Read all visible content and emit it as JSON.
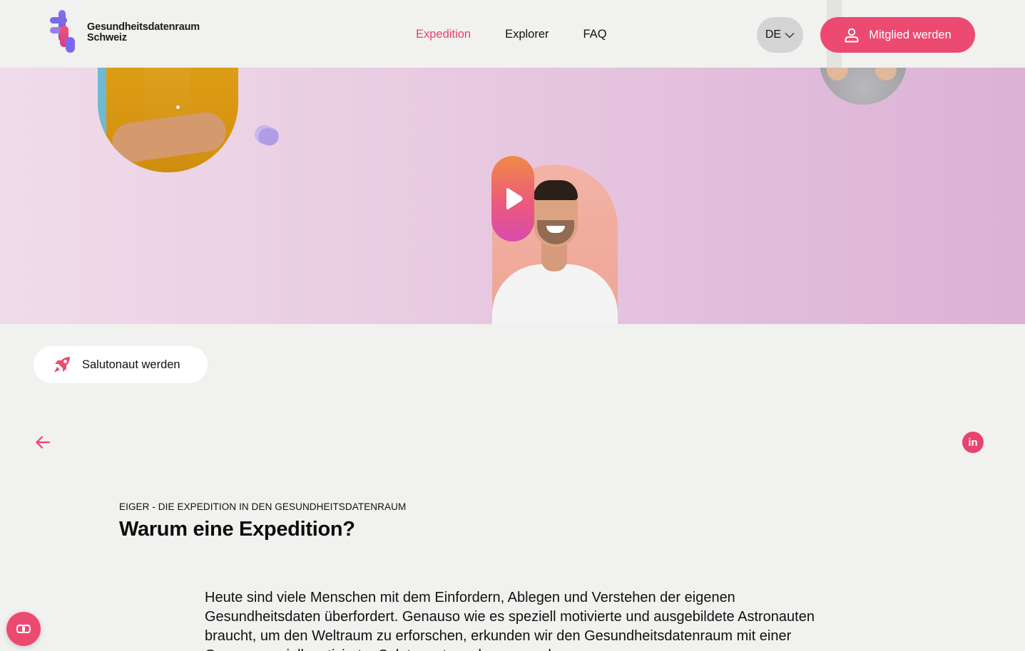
{
  "brand": {
    "name_line1": "Gesundheitsdatenraum",
    "name_line2": "Schweiz",
    "accent_color": "#ec4a71"
  },
  "nav": {
    "items": [
      {
        "label": "Expedition",
        "active": true
      },
      {
        "label": "Explorer",
        "active": false
      },
      {
        "label": "FAQ",
        "active": false
      }
    ]
  },
  "language": {
    "current": "DE",
    "icon": "chevron-down-icon"
  },
  "header_cta": {
    "label": "Mitglied werden",
    "icon": "user-icon"
  },
  "hero": {
    "play_icon": "play-icon"
  },
  "salutonaut_button": {
    "label": "Salutonaut werden",
    "icon": "rocket-icon"
  },
  "back": {
    "icon": "arrow-left-icon"
  },
  "share": {
    "icon": "linkedin-icon",
    "label": "in"
  },
  "article": {
    "eyebrow": "EIGER - DIE EXPEDITION IN DEN GESUNDHEITSDATENRAUM",
    "title": "Warum eine Expedition?",
    "body": "Heute sind viele Menschen mit dem Einfordern, Ablegen und Verstehen der eigenen Gesundheitsdaten überfordert. Genauso wie es speziell motivierte und ausgebildete Astronauten braucht, um den Weltraum zu erforschen, erkunden wir den Gesundheitsdatenraum mit einer Gruppe speziell motivierter Salutonauten, also von und"
  },
  "floating_action": {
    "icon": "glasses-icon"
  }
}
